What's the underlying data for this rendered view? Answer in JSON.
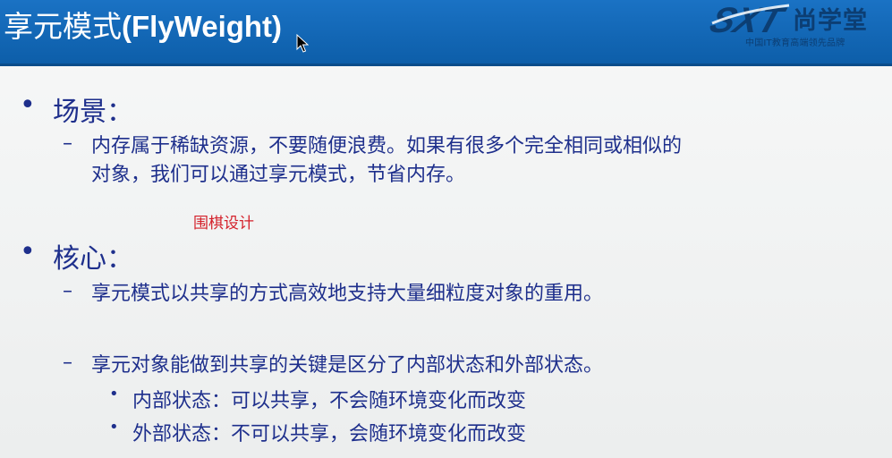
{
  "slide": {
    "title_cn": "享元模式",
    "title_en": "(FlyWeight)"
  },
  "logo": {
    "mark_text": "SXT",
    "brand": "尚学堂",
    "slogan": "中国IT教育高端领先品牌"
  },
  "sections": [
    {
      "bullet": "•",
      "heading": "场景：",
      "items": [
        {
          "bullet": "–",
          "lines": [
            "内存属于稀缺资源，不要随便浪费。如果有很多个完全相同或相似的",
            "对象，我们可以通过享元模式，节省内存。"
          ]
        }
      ]
    },
    {
      "bullet": "•",
      "heading": "核心：",
      "items": [
        {
          "bullet": "–",
          "lines": [
            "享元模式以共享的方式高效地支持大量细粒度对象的重用。"
          ]
        },
        {
          "bullet": "–",
          "lines": [
            "享元对象能做到共享的关键是区分了内部状态和外部状态。"
          ],
          "subitems": [
            {
              "bullet": "•",
              "text": "内部状态：可以共享，不会随环境变化而改变"
            },
            {
              "bullet": "•",
              "text": "外部状态：不可以共享，会随环境变化而改变"
            }
          ]
        }
      ]
    }
  ],
  "annotation": "围棋设计",
  "colors": {
    "header_blue": "#1a72c4",
    "text_navy": "#1e2f8c",
    "annotation_red": "#d4202a",
    "logo_navy": "#0c3e73"
  },
  "icons": {
    "cursor": "mouse-pointer-icon",
    "logo": "sxt-logo-mark"
  }
}
